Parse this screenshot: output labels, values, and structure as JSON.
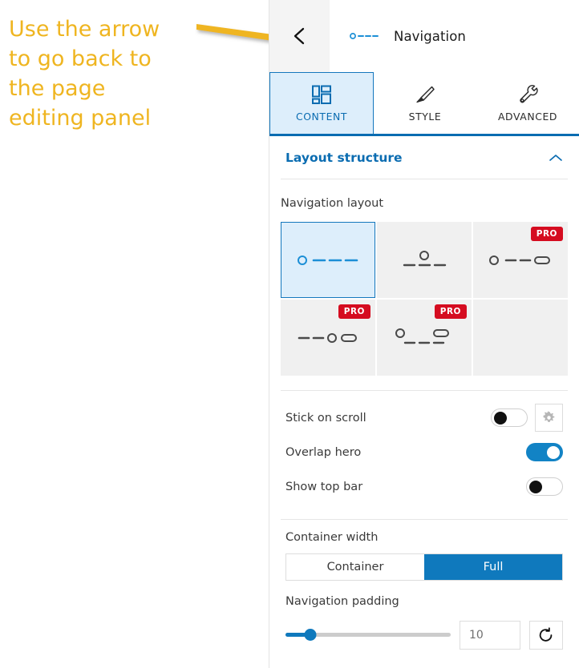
{
  "annotation": {
    "text": "Use the arrow\nto go back to\nthe page\nediting panel",
    "color": "#efb520",
    "arrow_icon": "arrow-right-pointer"
  },
  "header": {
    "back_icon": "chevron-left-icon",
    "widget_icon": "navigation-layout-icon",
    "title": "Navigation"
  },
  "tabs": [
    {
      "label": "CONTENT",
      "icon": "layout-grid-icon",
      "active": true
    },
    {
      "label": "STYLE",
      "icon": "paint-brush-icon",
      "active": false
    },
    {
      "label": "ADVANCED",
      "icon": "wrench-icon",
      "active": false
    }
  ],
  "section": {
    "title": "Layout structure",
    "collapse_icon": "chevron-up-icon",
    "expanded": true
  },
  "navigation_layout": {
    "label": "Navigation layout",
    "options": [
      {
        "id": "logo-left-menu-right",
        "icon": "nav-logo-left-dashes",
        "selected": true,
        "pro": false,
        "pro_label": ""
      },
      {
        "id": "logo-center-menu-below",
        "icon": "nav-logo-center-dashes-below",
        "selected": false,
        "pro": false,
        "pro_label": ""
      },
      {
        "id": "logo-left-menu-button-right",
        "icon": "nav-logo-left-dashes-button",
        "selected": false,
        "pro": true,
        "pro_label": "PRO"
      },
      {
        "id": "menu-left-logo-center-button",
        "icon": "nav-dashes-logo-button",
        "selected": false,
        "pro": true,
        "pro_label": "PRO"
      },
      {
        "id": "logo-left-button-right-menu-below",
        "icon": "nav-logo-button-dashes-below",
        "selected": false,
        "pro": true,
        "pro_label": "PRO"
      }
    ]
  },
  "toggles": [
    {
      "label": "Stick on scroll",
      "on": false,
      "has_settings": true,
      "settings_icon": "gear-icon"
    },
    {
      "label": "Overlap hero",
      "on": true,
      "has_settings": false,
      "settings_icon": ""
    },
    {
      "label": "Show top bar",
      "on": false,
      "has_settings": false,
      "settings_icon": ""
    }
  ],
  "container_width": {
    "label": "Container width",
    "options": [
      {
        "label": "Container",
        "active": false
      },
      {
        "label": "Full",
        "active": true
      }
    ]
  },
  "navigation_padding": {
    "label": "Navigation padding",
    "value": "10",
    "slider_percent": 15,
    "reset_icon": "reset-ccw-icon"
  },
  "colors": {
    "accent": "#0a6cb1",
    "accent_fill": "#0f79bd",
    "tab_active_bg": "#ddeefb",
    "pro_badge": "#d50c20",
    "annotation": "#efb520",
    "cell_bg": "#f0f0f0"
  }
}
